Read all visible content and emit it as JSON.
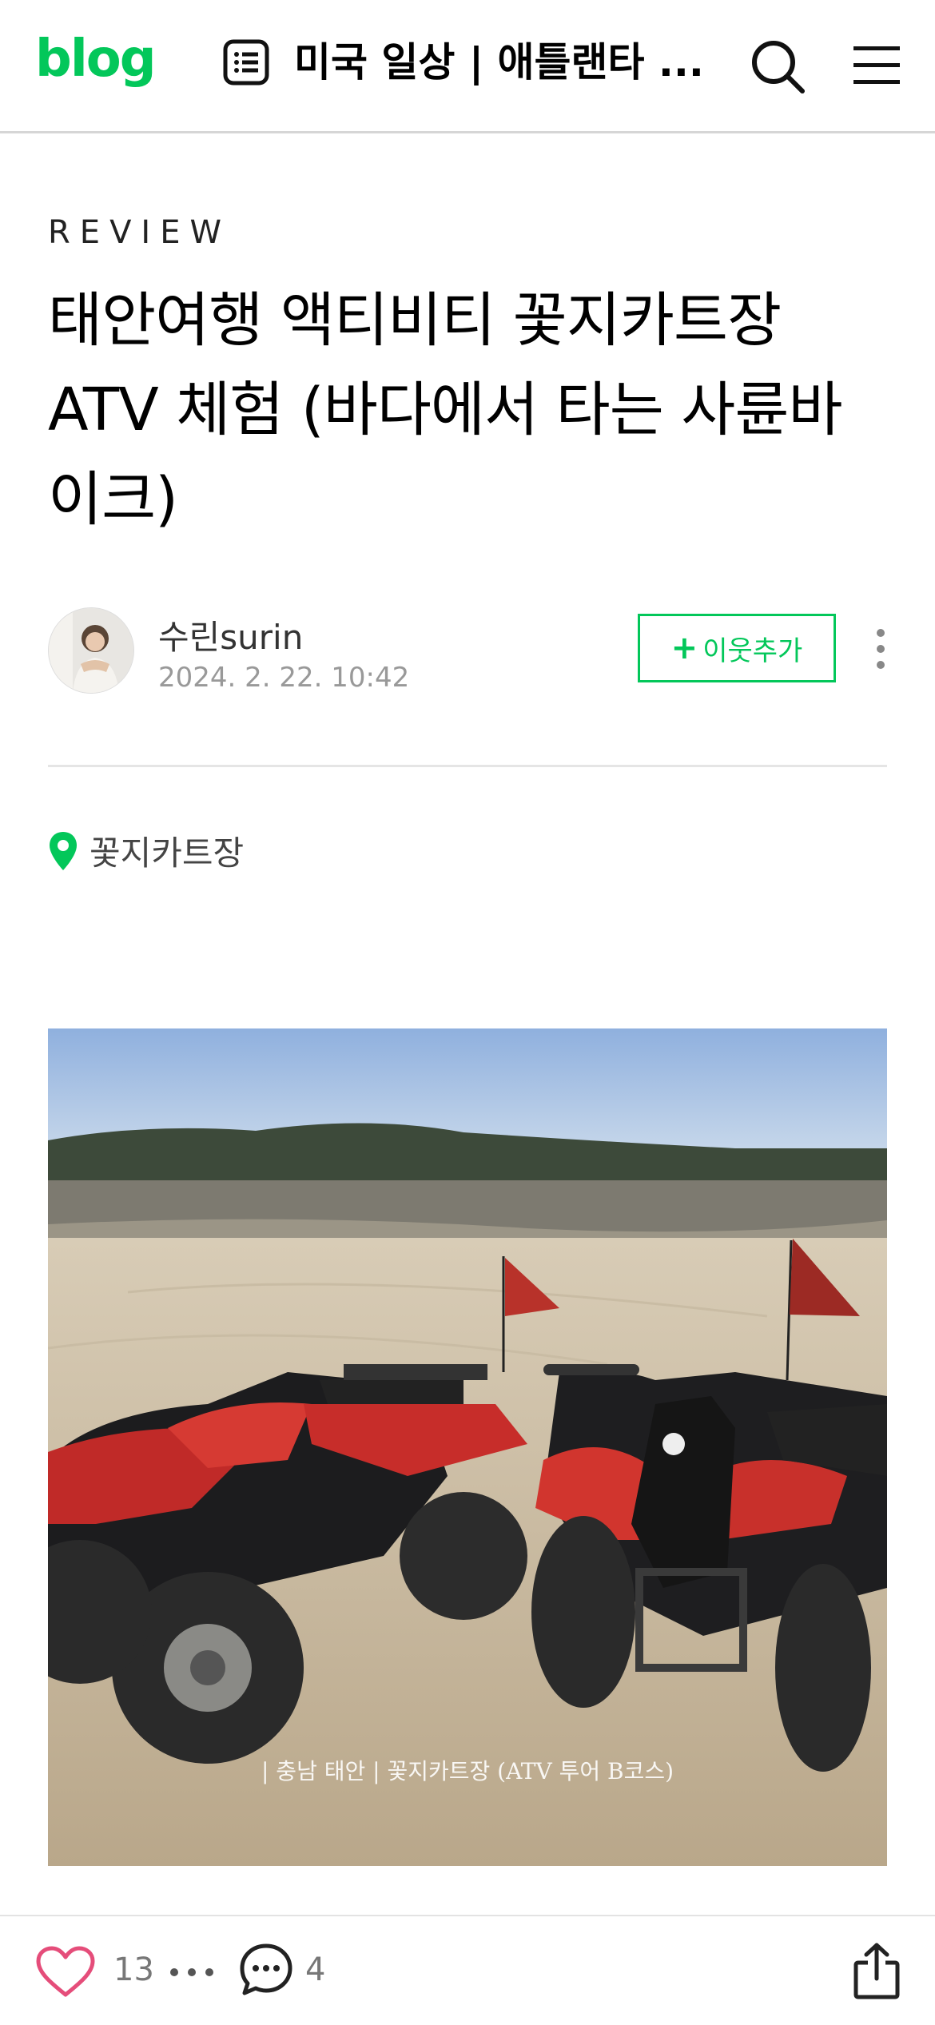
{
  "header": {
    "logo": "blog",
    "blog_title": "미국 일상 | 애틀랜타 ...",
    "icons": [
      "list-icon",
      "search-icon",
      "menu-icon"
    ]
  },
  "post": {
    "category": "REVIEW",
    "title": "태안여행 액티비티 꽃지카트장 ATV 체험 (바다에서 타는 사륜바이크)",
    "author": "수린surin",
    "date": "2024. 2. 22. 10:42",
    "follow_label": "이웃추가",
    "follow_plus": "+",
    "place": "꽃지카트장",
    "photo_caption": "| 충남 태안 | 꽃지카트장 (ATV 투어 B코스)"
  },
  "bottom_bar": {
    "like_count": "13",
    "comment_count": "4"
  },
  "colors": {
    "brand_green": "#03c75a",
    "heart_pink": "#e54d7a"
  }
}
